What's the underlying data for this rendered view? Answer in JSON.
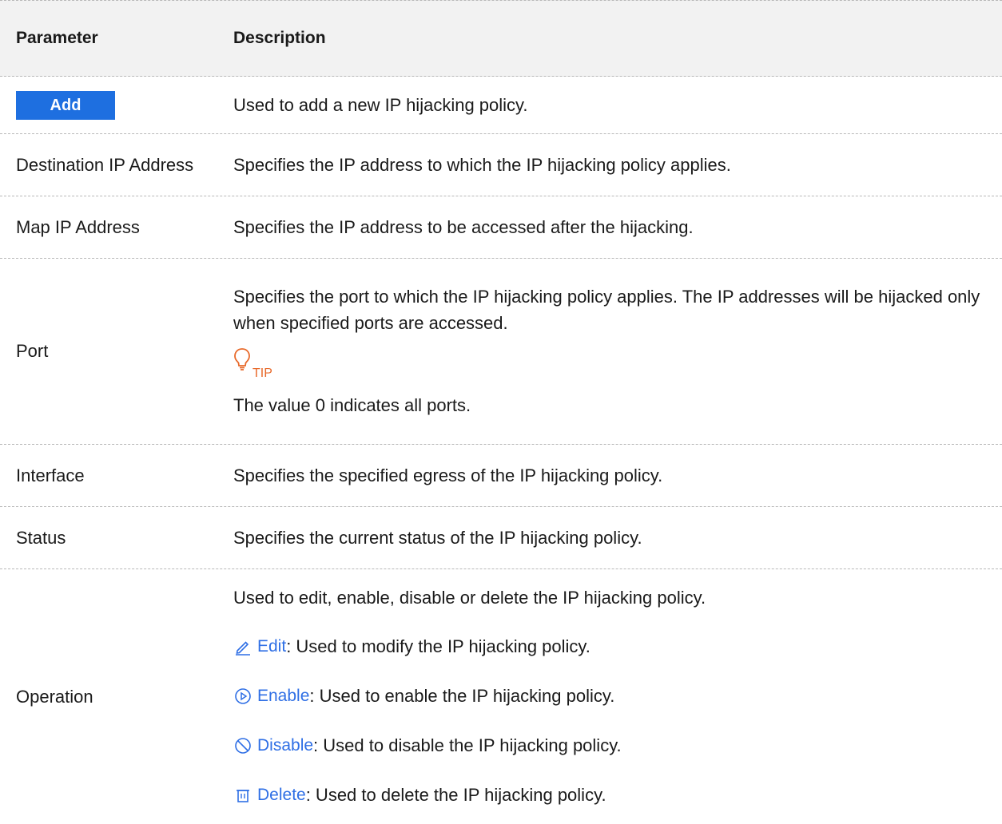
{
  "header": {
    "col1": "Parameter",
    "col2": "Description"
  },
  "rows": {
    "add": {
      "button_label": "Add",
      "desc": "Used to add a new IP hijacking policy."
    },
    "dest": {
      "param": "Destination IP Address",
      "desc": "Specifies the IP address to which the IP hijacking policy applies."
    },
    "map": {
      "param": "Map IP Address",
      "desc": "Specifies the IP address to be accessed after the hijacking."
    },
    "port": {
      "param": "Port",
      "desc": "Specifies the port to which the IP hijacking policy applies. The IP addresses will be hijacked only when specified ports are accessed.",
      "tip_label": "TIP",
      "tip_text": "The value 0 indicates all ports."
    },
    "iface": {
      "param": "Interface",
      "desc": "Specifies the specified egress of the IP hijacking policy."
    },
    "status": {
      "param": "Status",
      "desc": "Specifies the current status of the IP hijacking policy."
    },
    "operation": {
      "param": "Operation",
      "desc": "Used to edit, enable, disable or delete the IP hijacking policy.",
      "items": [
        {
          "icon": "pencil-icon",
          "label": "Edit",
          "desc": ": Used to modify the IP hijacking policy."
        },
        {
          "icon": "play-circle-icon",
          "label": "Enable",
          "desc": ": Used to enable the IP hijacking policy."
        },
        {
          "icon": "disable-circle-icon",
          "label": "Disable",
          "desc": ": Used to disable the IP hijacking policy."
        },
        {
          "icon": "trash-icon",
          "label": "Delete",
          "desc": ": Used to delete the IP hijacking policy."
        }
      ]
    }
  },
  "colors": {
    "add_button": "#1e6fe0",
    "link_blue": "#2f6fe5",
    "tip_orange": "#e8692a",
    "header_bg": "#f2f2f2"
  }
}
